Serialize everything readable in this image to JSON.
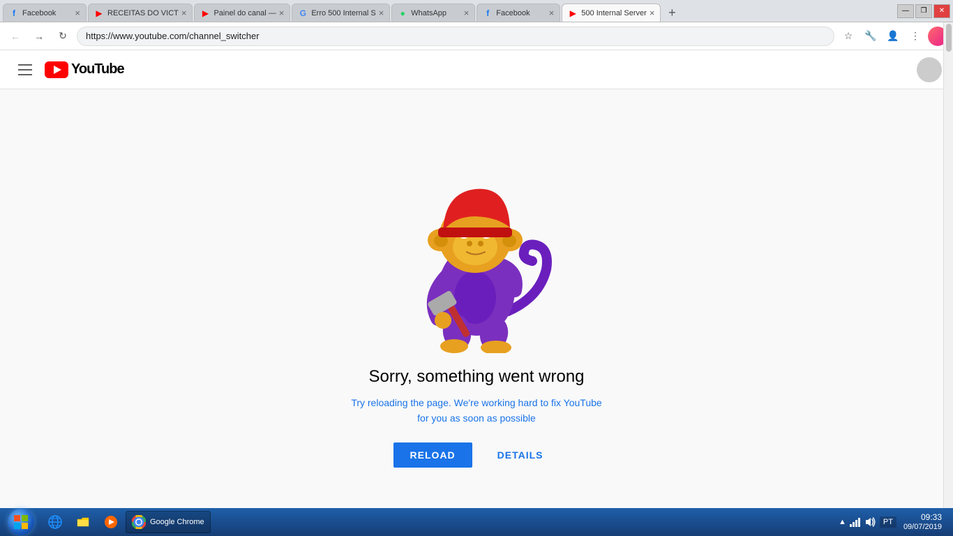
{
  "browser": {
    "title": "YouTube - 500 Internal Server",
    "url": "https://www.youtube.com/channel_switcher",
    "tabs": [
      {
        "id": "tab-fb1",
        "label": "Facebook",
        "favicon_type": "fb",
        "active": false
      },
      {
        "id": "tab-receitas",
        "label": "RECEITAS DO VICT",
        "favicon_type": "yt",
        "active": false
      },
      {
        "id": "tab-painel",
        "label": "Painel do canal —",
        "favicon_type": "yt",
        "active": false
      },
      {
        "id": "tab-erro500",
        "label": "Erro 500 Internal S",
        "favicon_type": "g",
        "active": false
      },
      {
        "id": "tab-whatsapp",
        "label": "WhatsApp",
        "favicon_type": "wa",
        "active": false
      },
      {
        "id": "tab-facebook2",
        "label": "Facebook",
        "favicon_type": "fb",
        "active": false
      },
      {
        "id": "tab-500internal",
        "label": "500 Internal Server",
        "favicon_type": "yt",
        "active": true
      }
    ],
    "window_controls": {
      "minimize": "—",
      "restore": "❐",
      "close": "✕"
    }
  },
  "youtube": {
    "logo_text": "YouTube",
    "header_title": "YouTube",
    "error": {
      "title": "Sorry, something went wrong",
      "subtitle_line1": "Try reloading the page. We're working hard to fix YouTube",
      "subtitle_line2": "for you as soon as possible",
      "reload_button": "RELOAD",
      "details_button": "DETAILS"
    }
  },
  "taskbar": {
    "language": "PT",
    "clock": {
      "time": "09:33",
      "date": "09/07/2019"
    },
    "programs": [
      {
        "id": "start",
        "label": "Start"
      },
      {
        "id": "ie",
        "label": "Internet Explorer"
      },
      {
        "id": "files",
        "label": "Files"
      },
      {
        "id": "media",
        "label": "Media Player"
      },
      {
        "id": "chrome",
        "label": "Google Chrome",
        "active": true
      }
    ]
  }
}
